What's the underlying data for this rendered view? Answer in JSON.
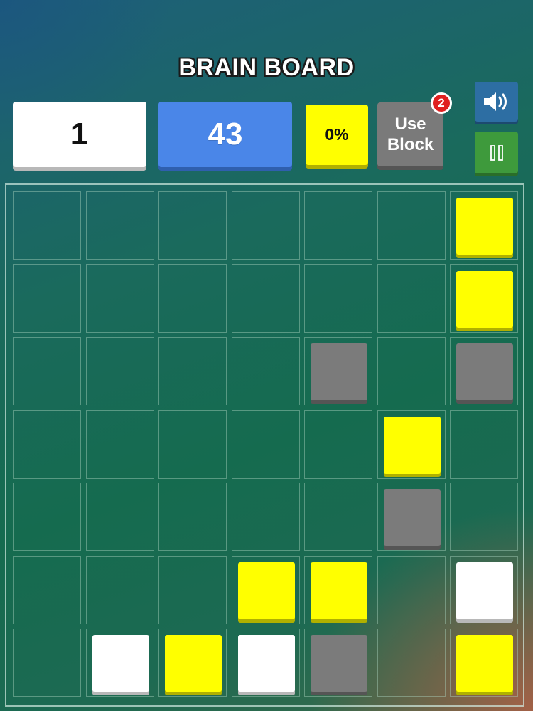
{
  "game": {
    "title": "BRAIN BOARD"
  },
  "hud": {
    "level": "1",
    "moves": "43",
    "progress": "0%",
    "use_block_line1": "Use",
    "use_block_line2": "Block",
    "use_block_count": "2"
  },
  "controls": {
    "sound_icon": "speaker-volume-icon",
    "pause_icon": "pause-icon"
  },
  "colors": {
    "yellow": "#ffff00",
    "gray": "#7b7b7b",
    "white": "#ffffff",
    "moves_blue": "#4a86e8",
    "badge_red": "#e02020",
    "sound_blue": "#2d6ea3",
    "pause_green": "#3e9a3c"
  },
  "board": {
    "rows": 7,
    "cols": 7,
    "grid": [
      [
        "",
        "",
        "",
        "",
        "",
        "",
        "yellow"
      ],
      [
        "",
        "",
        "",
        "",
        "",
        "",
        "yellow"
      ],
      [
        "",
        "",
        "",
        "",
        "gray",
        "",
        "gray"
      ],
      [
        "",
        "",
        "",
        "",
        "",
        "yellow",
        ""
      ],
      [
        "",
        "",
        "",
        "",
        "",
        "gray",
        ""
      ],
      [
        "",
        "",
        "",
        "yellow",
        "yellow",
        "",
        "white"
      ],
      [
        "",
        "white",
        "yellow",
        "white",
        "gray",
        "",
        "yellow"
      ]
    ]
  }
}
